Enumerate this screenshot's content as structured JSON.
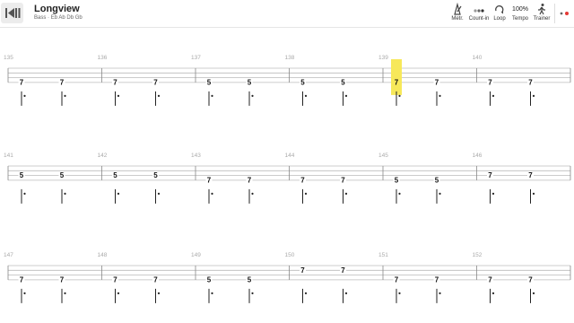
{
  "song": {
    "title": "Longview",
    "instrument": "Bass",
    "tuning": "Eb Ab Db Gb"
  },
  "toolbar": {
    "metronome": "Metr.",
    "countin": "Count-in",
    "loop": "Loop",
    "tempo_value": "100%",
    "tempo": "Tempo",
    "trainer": "Trainer"
  },
  "colors": {
    "highlight": "#f7e85a",
    "staff_line": "#bcbcbc",
    "measure_number": "#aaaaaa"
  },
  "score": {
    "strings": 4,
    "highlighted_note": {
      "measure": "139",
      "index": 0
    },
    "systems": [
      {
        "measures": [
          {
            "number": "135",
            "notes": [
              {
                "fret": "7",
                "string": 4
              },
              {
                "fret": "7",
                "string": 4
              }
            ]
          },
          {
            "number": "136",
            "notes": [
              {
                "fret": "7",
                "string": 4
              },
              {
                "fret": "7",
                "string": 4
              }
            ]
          },
          {
            "number": "137",
            "notes": [
              {
                "fret": "5",
                "string": 4
              },
              {
                "fret": "5",
                "string": 4
              }
            ]
          },
          {
            "number": "138",
            "notes": [
              {
                "fret": "5",
                "string": 4
              },
              {
                "fret": "5",
                "string": 4
              }
            ]
          },
          {
            "number": "139",
            "notes": [
              {
                "fret": "7",
                "string": 4
              },
              {
                "fret": "7",
                "string": 4
              }
            ]
          },
          {
            "number": "140",
            "notes": [
              {
                "fret": "7",
                "string": 4
              },
              {
                "fret": "7",
                "string": 4
              }
            ]
          }
        ]
      },
      {
        "measures": [
          {
            "number": "141",
            "notes": [
              {
                "fret": "5",
                "string": 3
              },
              {
                "fret": "5",
                "string": 3
              }
            ]
          },
          {
            "number": "142",
            "notes": [
              {
                "fret": "5",
                "string": 3
              },
              {
                "fret": "5",
                "string": 3
              }
            ]
          },
          {
            "number": "143",
            "notes": [
              {
                "fret": "7",
                "string": 4
              },
              {
                "fret": "7",
                "string": 4
              }
            ]
          },
          {
            "number": "144",
            "notes": [
              {
                "fret": "7",
                "string": 4
              },
              {
                "fret": "7",
                "string": 4
              }
            ]
          },
          {
            "number": "145",
            "notes": [
              {
                "fret": "5",
                "string": 4
              },
              {
                "fret": "5",
                "string": 4
              }
            ]
          },
          {
            "number": "146",
            "notes": [
              {
                "fret": "7",
                "string": 3
              },
              {
                "fret": "7",
                "string": 3
              }
            ]
          }
        ]
      },
      {
        "measures": [
          {
            "number": "147",
            "notes": [
              {
                "fret": "7",
                "string": 4
              },
              {
                "fret": "7",
                "string": 4
              }
            ]
          },
          {
            "number": "148",
            "notes": [
              {
                "fret": "7",
                "string": 4
              },
              {
                "fret": "7",
                "string": 4
              }
            ]
          },
          {
            "number": "149",
            "notes": [
              {
                "fret": "5",
                "string": 4
              },
              {
                "fret": "5",
                "string": 4
              }
            ]
          },
          {
            "number": "150",
            "notes": [
              {
                "fret": "7",
                "string": 2
              },
              {
                "fret": "7",
                "string": 2
              }
            ]
          },
          {
            "number": "151",
            "notes": [
              {
                "fret": "7",
                "string": 4
              },
              {
                "fret": "7",
                "string": 4
              }
            ]
          },
          {
            "number": "152",
            "notes": [
              {
                "fret": "7",
                "string": 4
              },
              {
                "fret": "7",
                "string": 4
              }
            ]
          }
        ]
      }
    ]
  }
}
